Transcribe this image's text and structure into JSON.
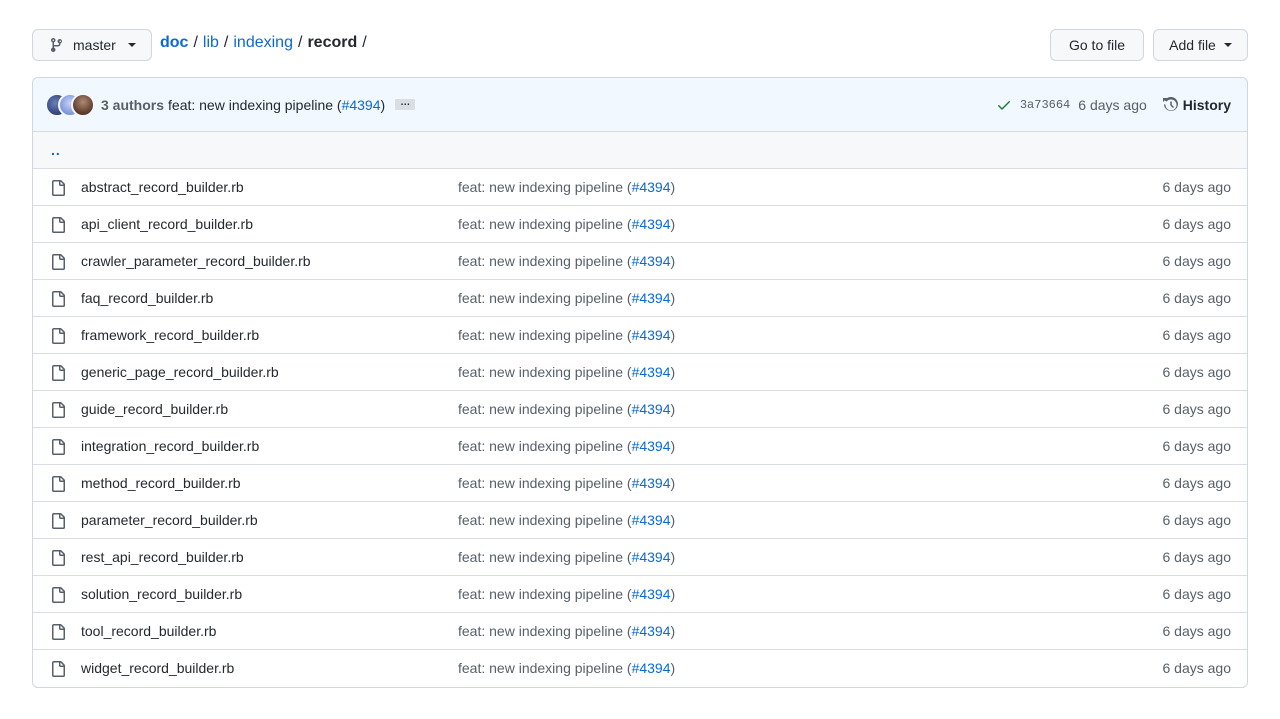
{
  "branch": {
    "name": "master",
    "icon": "git-branch-icon"
  },
  "breadcrumb": {
    "root": "doc",
    "parts": [
      "lib",
      "indexing"
    ],
    "current": "record",
    "separator": "/"
  },
  "actions": {
    "goto_file": "Go to file",
    "add_file": "Add file"
  },
  "commit": {
    "authors": "3 authors",
    "message": "feat: new indexing pipeline (",
    "pr": "#4394",
    "message_end": ")",
    "ellipsis": "…",
    "sha": "3a73664",
    "age": "6 days ago",
    "history": "History"
  },
  "updir": "..",
  "files": [
    {
      "name": "abstract_record_builder.rb",
      "msg": "feat: new indexing pipeline (",
      "pr": "#4394",
      "end": ")",
      "age": "6 days ago"
    },
    {
      "name": "api_client_record_builder.rb",
      "msg": "feat: new indexing pipeline (",
      "pr": "#4394",
      "end": ")",
      "age": "6 days ago"
    },
    {
      "name": "crawler_parameter_record_builder.rb",
      "msg": "feat: new indexing pipeline (",
      "pr": "#4394",
      "end": ")",
      "age": "6 days ago"
    },
    {
      "name": "faq_record_builder.rb",
      "msg": "feat: new indexing pipeline (",
      "pr": "#4394",
      "end": ")",
      "age": "6 days ago"
    },
    {
      "name": "framework_record_builder.rb",
      "msg": "feat: new indexing pipeline (",
      "pr": "#4394",
      "end": ")",
      "age": "6 days ago"
    },
    {
      "name": "generic_page_record_builder.rb",
      "msg": "feat: new indexing pipeline (",
      "pr": "#4394",
      "end": ")",
      "age": "6 days ago"
    },
    {
      "name": "guide_record_builder.rb",
      "msg": "feat: new indexing pipeline (",
      "pr": "#4394",
      "end": ")",
      "age": "6 days ago"
    },
    {
      "name": "integration_record_builder.rb",
      "msg": "feat: new indexing pipeline (",
      "pr": "#4394",
      "end": ")",
      "age": "6 days ago"
    },
    {
      "name": "method_record_builder.rb",
      "msg": "feat: new indexing pipeline (",
      "pr": "#4394",
      "end": ")",
      "age": "6 days ago"
    },
    {
      "name": "parameter_record_builder.rb",
      "msg": "feat: new indexing pipeline (",
      "pr": "#4394",
      "end": ")",
      "age": "6 days ago"
    },
    {
      "name": "rest_api_record_builder.rb",
      "msg": "feat: new indexing pipeline (",
      "pr": "#4394",
      "end": ")",
      "age": "6 days ago"
    },
    {
      "name": "solution_record_builder.rb",
      "msg": "feat: new indexing pipeline (",
      "pr": "#4394",
      "end": ")",
      "age": "6 days ago"
    },
    {
      "name": "tool_record_builder.rb",
      "msg": "feat: new indexing pipeline (",
      "pr": "#4394",
      "end": ")",
      "age": "6 days ago"
    },
    {
      "name": "widget_record_builder.rb",
      "msg": "feat: new indexing pipeline (",
      "pr": "#4394",
      "end": ")",
      "age": "6 days ago"
    }
  ],
  "colors": {
    "link": "#0969da",
    "muted": "#57606a",
    "success": "#1a7f37",
    "border": "#d0d7de"
  }
}
